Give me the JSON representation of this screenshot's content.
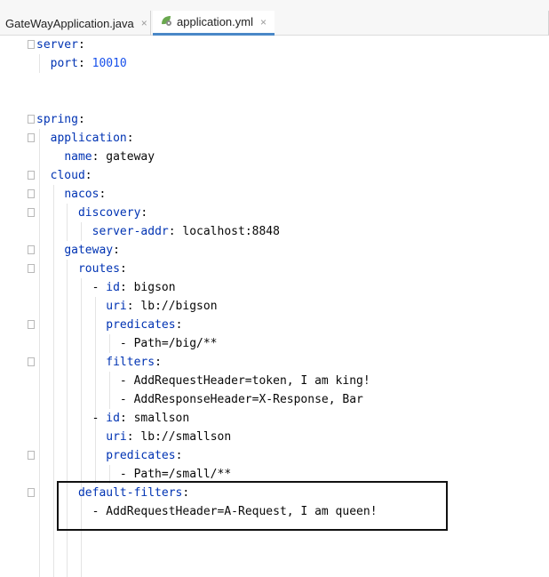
{
  "tabs": [
    {
      "label": "GateWayApplication.java",
      "close": "×",
      "active": false
    },
    {
      "label": "application.yml",
      "close": "×",
      "active": true
    }
  ],
  "code_lines": [
    {
      "indent": 0,
      "key": "server",
      "sep": ":",
      "value": "",
      "value_type": "text"
    },
    {
      "indent": 1,
      "key": "port",
      "sep": ": ",
      "value": "10010",
      "value_type": "number"
    },
    {
      "indent": 0,
      "key": "",
      "sep": "",
      "value": "",
      "value_type": "text"
    },
    {
      "indent": 0,
      "key": "",
      "sep": "",
      "value": "",
      "value_type": "text"
    },
    {
      "indent": 0,
      "key": "spring",
      "sep": ":",
      "value": "",
      "value_type": "text"
    },
    {
      "indent": 1,
      "key": "application",
      "sep": ":",
      "value": "",
      "value_type": "text"
    },
    {
      "indent": 2,
      "key": "name",
      "sep": ": ",
      "value": "gateway",
      "value_type": "text"
    },
    {
      "indent": 1,
      "key": "cloud",
      "sep": ":",
      "value": "",
      "value_type": "text"
    },
    {
      "indent": 2,
      "key": "nacos",
      "sep": ":",
      "value": "",
      "value_type": "text"
    },
    {
      "indent": 3,
      "key": "discovery",
      "sep": ":",
      "value": "",
      "value_type": "text"
    },
    {
      "indent": 4,
      "key": "server-addr",
      "sep": ": ",
      "value": "localhost:8848",
      "value_type": "text"
    },
    {
      "indent": 2,
      "key": "gateway",
      "sep": ":",
      "value": "",
      "value_type": "text"
    },
    {
      "indent": 3,
      "key": "routes",
      "sep": ":",
      "value": "",
      "value_type": "text"
    },
    {
      "indent": 4,
      "dash": "- ",
      "key": "id",
      "sep": ": ",
      "value": "bigson",
      "value_type": "text"
    },
    {
      "indent": 5,
      "key": "uri",
      "sep": ": ",
      "value": "lb://bigson",
      "value_type": "text"
    },
    {
      "indent": 5,
      "key": "predicates",
      "sep": ":",
      "value": "",
      "value_type": "text"
    },
    {
      "indent": 6,
      "dash": "- ",
      "key": "",
      "sep": "",
      "value": "Path=/big/**",
      "value_type": "text"
    },
    {
      "indent": 5,
      "key": "filters",
      "sep": ":",
      "value": "",
      "value_type": "text"
    },
    {
      "indent": 6,
      "dash": "- ",
      "key": "",
      "sep": "",
      "value": "AddRequestHeader=token, I am king!",
      "value_type": "text"
    },
    {
      "indent": 6,
      "dash": "- ",
      "key": "",
      "sep": "",
      "value": "AddResponseHeader=X-Response, Bar",
      "value_type": "text"
    },
    {
      "indent": 4,
      "dash": "- ",
      "key": "id",
      "sep": ": ",
      "value": "smallson",
      "value_type": "text"
    },
    {
      "indent": 5,
      "key": "uri",
      "sep": ": ",
      "value": "lb://smallson",
      "value_type": "text"
    },
    {
      "indent": 5,
      "key": "predicates",
      "sep": ":",
      "value": "",
      "value_type": "text"
    },
    {
      "indent": 6,
      "dash": "- ",
      "key": "",
      "sep": "",
      "value": "Path=/small/**",
      "value_type": "text"
    },
    {
      "indent": 3,
      "key": "default-filters",
      "sep": ":",
      "value": "",
      "value_type": "text"
    },
    {
      "indent": 4,
      "dash": "- ",
      "key": "",
      "sep": "",
      "value": "AddRequestHeader=A-Request, I am queen!",
      "value_type": "text"
    }
  ],
  "colors": {
    "key": "#0033b3",
    "value": "#080808",
    "number": "#1750eb",
    "active_tab_underline": "#4a88c7",
    "highlight_box": "#111111"
  }
}
